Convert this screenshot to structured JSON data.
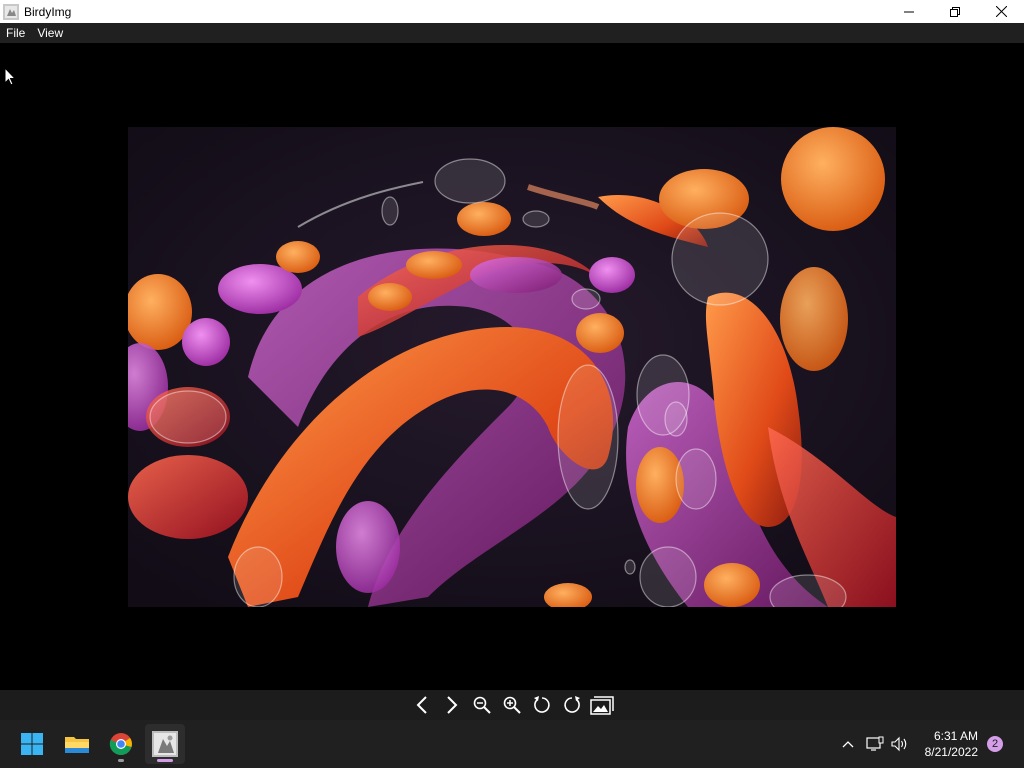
{
  "window": {
    "title": "BirdyImg"
  },
  "menu": {
    "items": [
      "File",
      "View"
    ]
  },
  "toolbar": {
    "buttons": [
      "previous-icon",
      "next-icon",
      "zoom-out-icon",
      "zoom-in-icon",
      "rotate-left-icon",
      "rotate-right-icon",
      "gallery-icon"
    ]
  },
  "taskbar": {
    "apps": [
      "start-icon",
      "file-explorer-icon",
      "chrome-icon",
      "birdyimg-icon"
    ],
    "clock_time": "6:31 AM",
    "clock_date": "8/21/2022",
    "notification_count": "2"
  },
  "colors": {
    "accent": "#d49ee8",
    "taskbar": "#202020",
    "menubar": "#202020"
  }
}
